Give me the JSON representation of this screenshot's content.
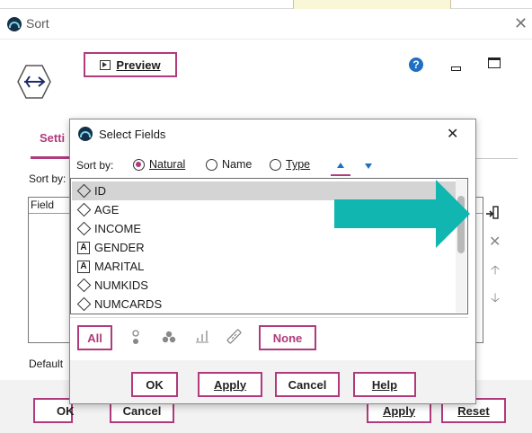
{
  "window": {
    "title": "Sort"
  },
  "toolbar": {
    "preview_label": "Preview"
  },
  "tabs": {
    "settings_label_partial": "Setti"
  },
  "sort_panel": {
    "sort_by_label_partial": "Sort by:",
    "field_header_partial": "Field",
    "default_label_partial": "Default"
  },
  "main_buttons": {
    "ok_partial": "OK",
    "cancel_partial": "Cancel",
    "apply_partial": "Apply",
    "reset_partial": "Reset"
  },
  "dialog": {
    "title": "Select Fields",
    "sort_by_label": "Sort by:",
    "radio_natural": "Natural",
    "radio_name": "Name",
    "radio_type": "Type",
    "fields": [
      {
        "name": "ID",
        "type": "diamond",
        "selected": true
      },
      {
        "name": "AGE",
        "type": "diamond",
        "selected": false
      },
      {
        "name": "INCOME",
        "type": "diamond",
        "selected": false
      },
      {
        "name": "GENDER",
        "type": "A",
        "selected": false
      },
      {
        "name": "MARITAL",
        "type": "A",
        "selected": false
      },
      {
        "name": "NUMKIDS",
        "type": "diamond",
        "selected": false
      },
      {
        "name": "NUMCARDS",
        "type": "diamond",
        "selected": false
      }
    ],
    "type_filter": {
      "all": "All",
      "none": "None"
    },
    "buttons": {
      "ok": "OK",
      "apply": "Apply",
      "cancel": "Cancel",
      "help": "Help"
    }
  },
  "colors": {
    "accent": "#b03a7b",
    "help": "#1f6fc2",
    "arrow": "#12b6b0"
  }
}
